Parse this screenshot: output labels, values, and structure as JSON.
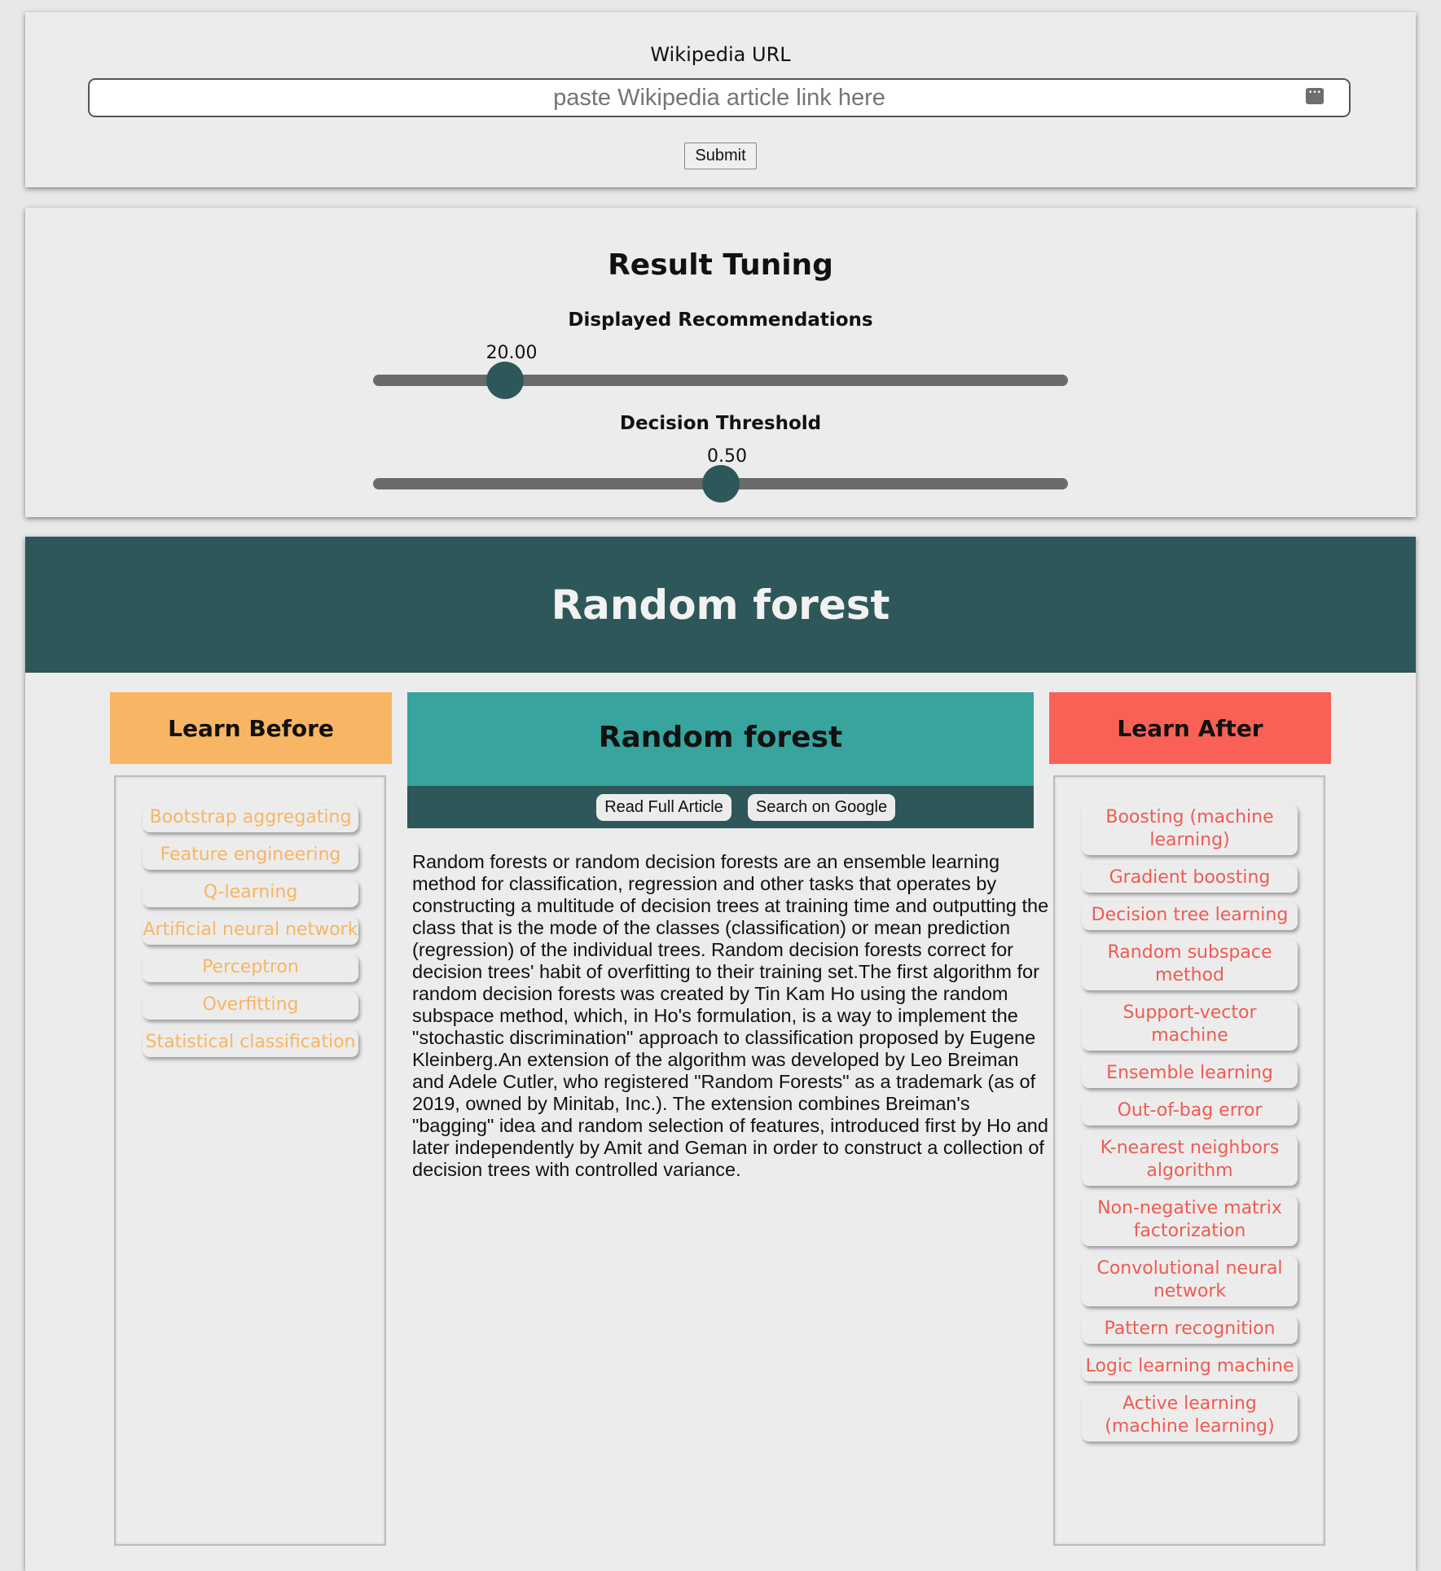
{
  "url_form": {
    "label": "Wikipedia URL",
    "input_value": "",
    "input_placeholder": "paste Wikipedia article link here",
    "submit_label": "Submit"
  },
  "tuning": {
    "title": "Result Tuning",
    "recommendations": {
      "label": "Displayed Recommendations",
      "value_text": "20.00",
      "value": 20,
      "fraction": 0.19
    },
    "threshold": {
      "label": "Decision Threshold",
      "value_text": "0.50",
      "value": 0.5,
      "fraction": 0.5
    }
  },
  "result": {
    "title": "Random forest",
    "learn_before": {
      "heading": "Learn Before",
      "items": [
        "Bootstrap aggregating",
        "Feature engineering",
        "Q-learning",
        "Artificial neural network",
        "Perceptron",
        "Overfitting",
        "Statistical classification"
      ]
    },
    "article": {
      "title": "Random forest",
      "read_label": "Read Full Article",
      "google_label": "Search on Google",
      "text": "Random forests or random decision forests are an ensemble learning method for classification, regression and other tasks that operates by constructing a multitude of decision trees at training time and outputting the class that is the mode of the classes (classification) or mean prediction (regression) of the individual trees. Random decision forests correct for decision trees' habit of overfitting to their training set.The first algorithm for random decision forests was created by Tin Kam Ho using the random subspace method, which, in Ho's formulation, is a way to implement the \"stochastic discrimination\" approach to classification proposed by Eugene Kleinberg.An extension of the algorithm was developed by Leo Breiman and Adele Cutler, who registered \"Random Forests\" as a trademark (as of 2019, owned by Minitab, Inc.). The extension combines Breiman's \"bagging\" idea and random selection of features, introduced first by Ho and later independently by Amit and Geman in order to construct a collection of decision trees with controlled variance."
    },
    "learn_after": {
      "heading": "Learn After",
      "items": [
        "Boosting (machine learning)",
        "Gradient boosting",
        "Decision tree learning",
        "Random subspace method",
        "Support-vector machine",
        "Ensemble learning",
        "Out-of-bag error",
        "K-nearest neighbors algorithm",
        "Non-negative matrix factorization",
        "Convolutional neural network",
        "Pattern recognition",
        "Logic learning machine",
        "Active learning (machine learning)"
      ]
    }
  },
  "colors": {
    "dark_teal": "#2e5759",
    "teal": "#37a49e",
    "orange": "#f8b563",
    "red": "#f96156"
  }
}
